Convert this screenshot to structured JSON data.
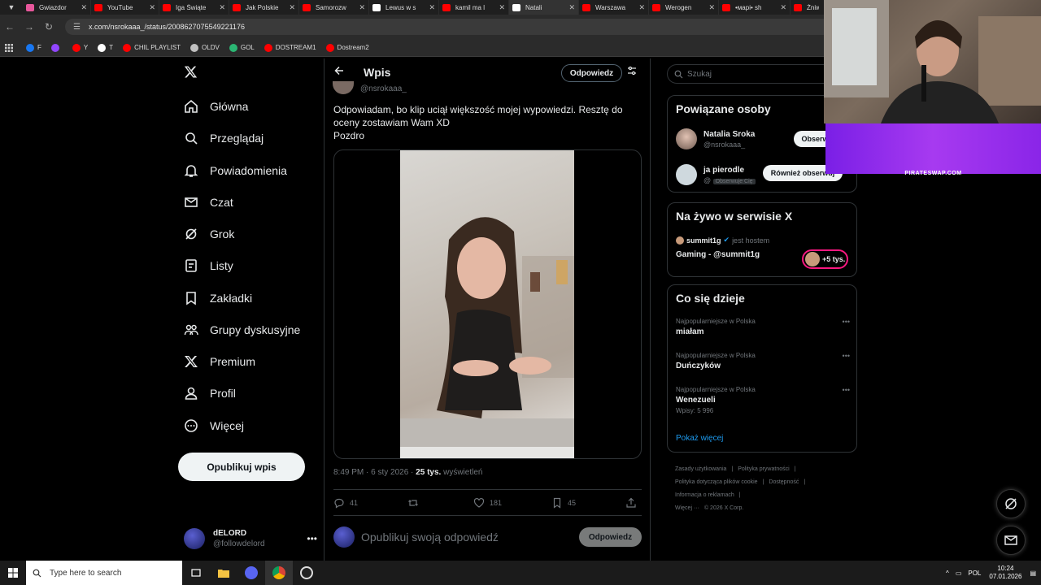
{
  "browser": {
    "tabs": [
      {
        "label": "Gwiazdor",
        "color": "#e8579b"
      },
      {
        "label": "YouTube",
        "color": "#ff0000"
      },
      {
        "label": "Iga Świąte",
        "color": "#ff0000"
      },
      {
        "label": "Jak Polskie",
        "color": "#ff0000"
      },
      {
        "label": "Samorozw",
        "color": "#ff0000"
      },
      {
        "label": "Lewus w s",
        "color": "#ffffff"
      },
      {
        "label": "kamil ma l",
        "color": "#ff0000"
      },
      {
        "label": "Natali",
        "color": "#ffffff",
        "active": true
      },
      {
        "label": "Warszawa",
        "color": "#ff0000"
      },
      {
        "label": "Werogen",
        "color": "#ff0000"
      },
      {
        "label": "•марі• sh",
        "color": "#ff0000"
      },
      {
        "label": "Żniwa",
        "color": "#ff0000"
      }
    ],
    "url": "x.com/nsrokaaa_/status/2008627075549221176",
    "bookmarks": [
      {
        "label": "F",
        "color": "#1877f2"
      },
      {
        "label": "",
        "color": "#9146ff"
      },
      {
        "label": "Y",
        "color": "#ff0000"
      },
      {
        "label": "T",
        "color": "#ffffff"
      },
      {
        "label": "CHIL PLAYLIST",
        "color": "#ff0000"
      },
      {
        "label": "OLDV",
        "color": "#c0c0c0"
      },
      {
        "label": "GOL",
        "color": "#2bb673"
      },
      {
        "label": "DOSTREAM1",
        "color": "#ff0000"
      },
      {
        "label": "Dostream2",
        "color": "#ff0000"
      }
    ]
  },
  "sidebar": {
    "logo": "X",
    "items": [
      {
        "label": "Główna",
        "icon": "home-icon"
      },
      {
        "label": "Przeglądaj",
        "icon": "search-icon"
      },
      {
        "label": "Powiadomienia",
        "icon": "bell-icon"
      },
      {
        "label": "Czat",
        "icon": "mail-icon"
      },
      {
        "label": "Grok",
        "icon": "grok-icon"
      },
      {
        "label": "Listy",
        "icon": "list-icon"
      },
      {
        "label": "Zakładki",
        "icon": "bookmark-icon"
      },
      {
        "label": "Grupy dyskusyjne",
        "icon": "people-icon"
      },
      {
        "label": "Premium",
        "icon": "x-icon"
      },
      {
        "label": "Profil",
        "icon": "person-icon"
      },
      {
        "label": "Więcej",
        "icon": "more-icon"
      }
    ],
    "post_button": "Opublikuj wpis",
    "user": {
      "name": "dELORD",
      "handle": "@followdelord"
    }
  },
  "main": {
    "header_title": "Wpis",
    "reply_button": "Odpowiedz",
    "author_handle": "@nsrokaaa_",
    "tweet_lines": [
      "Odpowiadam, bo klip uciął większość mojej wypowiedzi. Resztę do",
      "oceny zostawiam Wam XD",
      "Pozdro"
    ],
    "meta": {
      "time": "8:49 PM · 6 sty 2026 · ",
      "views": "25 tys.",
      "views_label": " wyświetleń"
    },
    "actions": {
      "replies": "41",
      "reposts": "",
      "likes": "181",
      "bookmarks": "45"
    },
    "reply_placeholder": "Opublikuj swoją odpowiedź",
    "reply_submit": "Odpowiedz"
  },
  "right": {
    "search_placeholder": "Szukaj",
    "related": {
      "title": "Powiązane osoby",
      "people": [
        {
          "name": "Natalia Sroka",
          "handle": "@nsrokaaa_",
          "button": "Obserwuj"
        },
        {
          "name": "ja pierodle",
          "handle": "@",
          "badge": "Obserwuje Cię",
          "button": "Również obserwuj"
        }
      ]
    },
    "live": {
      "title": "Na żywo w serwisie X",
      "host": "summit1g",
      "host_suffix": "jest hostem",
      "topic": "Gaming - @summit1g",
      "listeners": "+5 tys."
    },
    "trends": {
      "title": "Co się dzieje",
      "items": [
        {
          "context": "Najpopularniejsze w Polska",
          "name": "miałam",
          "count": ""
        },
        {
          "context": "Najpopularniejsze w Polska",
          "name": "Duńczyków",
          "count": ""
        },
        {
          "context": "Najpopularniejsze w Polska",
          "name": "Wenezueli",
          "count": "Wpisy: 5 996"
        }
      ],
      "show_more": "Pokaż więcej"
    },
    "footer": [
      "Zasady użytkowania",
      "|",
      "Polityka prywatności",
      "|",
      "Polityka dotycząca plików cookie",
      "|",
      "Dostępność",
      "|",
      "Informacja o reklamach",
      "|",
      "Więcej ···",
      "© 2026 X Corp."
    ]
  },
  "overlay": {
    "label": "PIRATESWAP.COM",
    "color": "#a13cf0"
  },
  "taskbar": {
    "search_placeholder": "Type here to search",
    "language": "POL",
    "time": "10:24",
    "date": "07.01.2026"
  },
  "colors": {
    "accent": "#1d9bf0",
    "background": "#000000",
    "border": "#2f3336",
    "muted": "#71767b"
  }
}
